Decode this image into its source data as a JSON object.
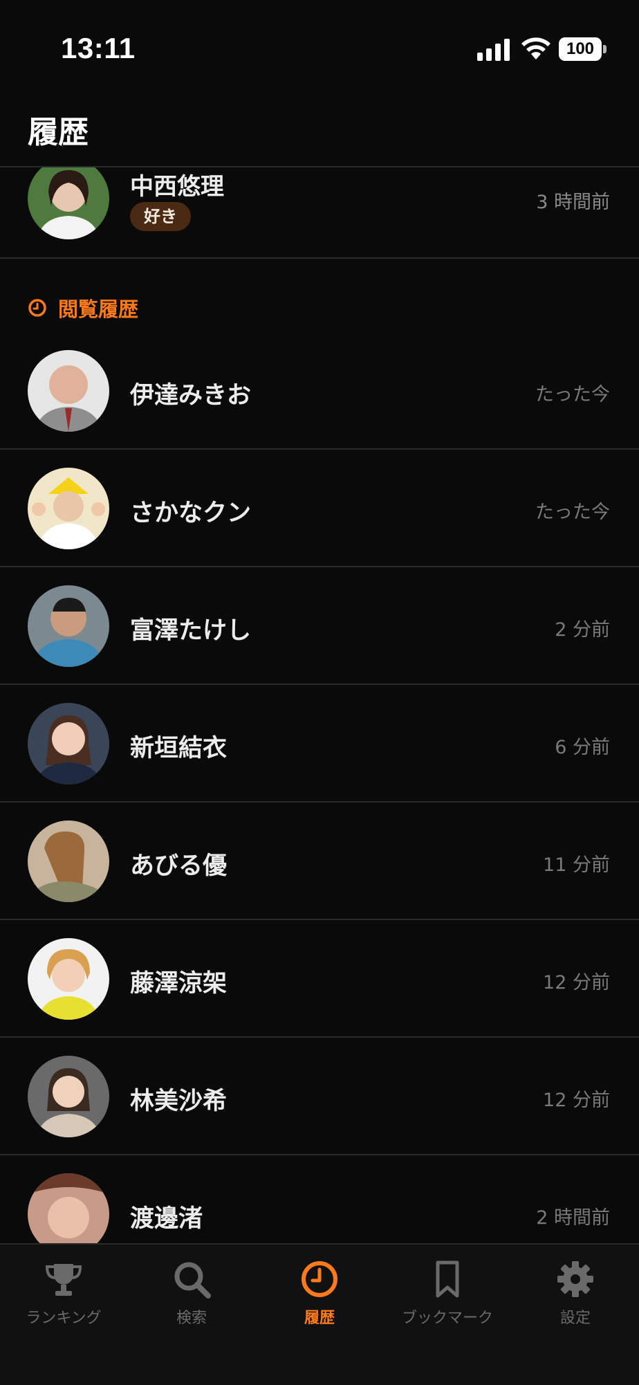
{
  "status_bar": {
    "time": "13:11",
    "battery": "100"
  },
  "header": {
    "title": "履歴"
  },
  "favorite": {
    "name": "中西悠理",
    "tag": "好き",
    "time": "3 時間前"
  },
  "history": {
    "section_label": "閲覧履歴",
    "items": [
      {
        "name": "伊達みきお",
        "time": "たった今",
        "avatar_color": "#d9d9d9"
      },
      {
        "name": "さかなクン",
        "time": "たった今",
        "avatar_color": "#e9e2c6"
      },
      {
        "name": "富澤たけし",
        "time": "2 分前",
        "avatar_color": "#5b7a8c"
      },
      {
        "name": "新垣結衣",
        "time": "6 分前",
        "avatar_color": "#3a4a5e"
      },
      {
        "name": "あびる優",
        "time": "11 分前",
        "avatar_color": "#b89c7c"
      },
      {
        "name": "藤澤涼架",
        "time": "12 分前",
        "avatar_color": "#e6e070"
      },
      {
        "name": "林美沙希",
        "time": "12 分前",
        "avatar_color": "#9a8c84"
      },
      {
        "name": "渡邊渚",
        "time": "2 時間前",
        "avatar_color": "#c89c8a"
      }
    ]
  },
  "tab_bar": {
    "tabs": [
      {
        "label": "ランキング",
        "icon": "trophy-icon"
      },
      {
        "label": "検索",
        "icon": "search-icon"
      },
      {
        "label": "履歴",
        "icon": "clock-icon",
        "active": true
      },
      {
        "label": "ブックマーク",
        "icon": "bookmark-icon"
      },
      {
        "label": "設定",
        "icon": "gear-icon"
      }
    ]
  },
  "colors": {
    "background": "#0a0a0a",
    "accent": "#ff7a1a",
    "divider": "#2a2a2a",
    "muted_text": "#7a7a7a",
    "tag_bg": "#4a2a12"
  }
}
